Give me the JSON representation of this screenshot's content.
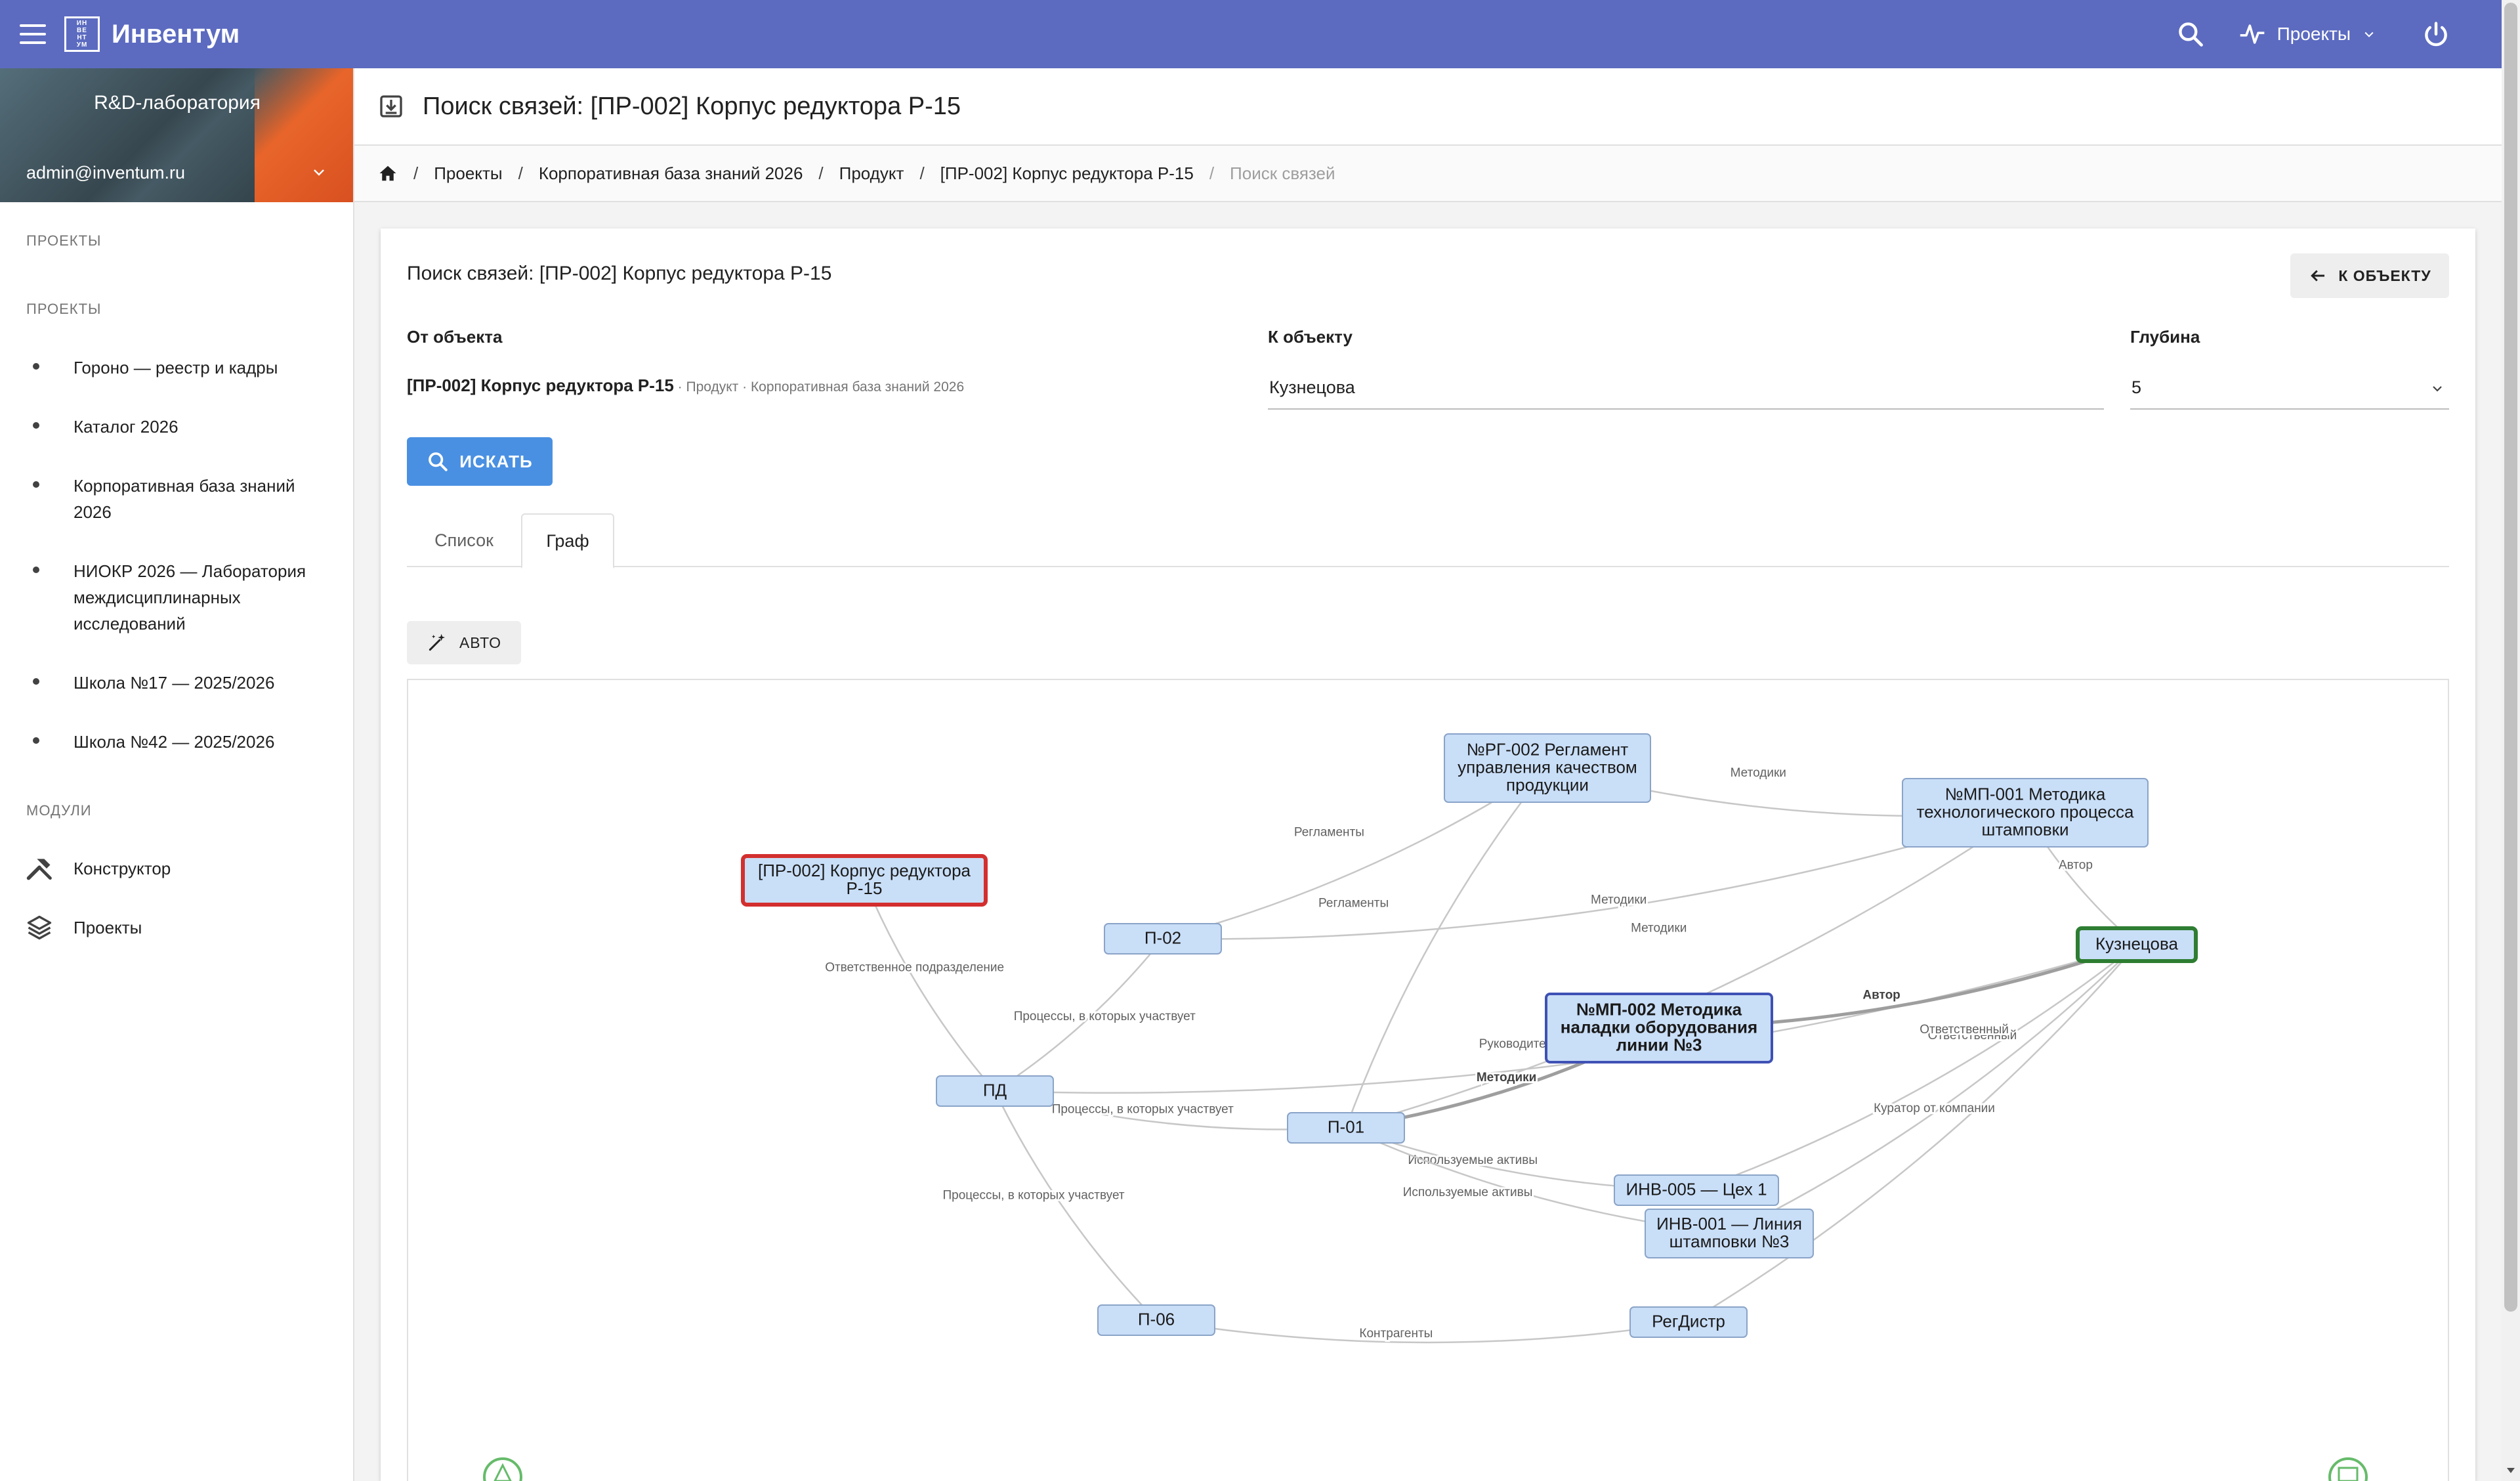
{
  "app": {
    "title": "Инвентум",
    "logo_text": "ИНВЕНТУМ"
  },
  "topbar": {
    "projects_label": "Проекты"
  },
  "sidebar": {
    "org": "R&D-лаборатория",
    "user": "admin@inventum.ru",
    "section_projects_1": "ПРОЕКТЫ",
    "section_projects_2": "ПРОЕКТЫ",
    "projects": [
      "Гороно — реестр и кадры",
      "Каталог 2026",
      "Корпоративная база знаний 2026",
      "НИОКР 2026 — Лаборатория междисциплинарных исследований",
      "Школа №17 — 2025/2026",
      "Школа №42 — 2025/2026"
    ],
    "section_modules": "МОДУЛИ",
    "modules": [
      "Конструктор",
      "Проекты"
    ]
  },
  "page": {
    "title": "Поиск связей: [ПР-002] Корпус редуктора Р-15",
    "breadcrumb": [
      "Проекты",
      "Корпоративная база знаний 2026",
      "Продукт",
      "[ПР-002] Корпус редуктора Р-15"
    ],
    "breadcrumb_current": "Поиск связей"
  },
  "card": {
    "title": "Поиск связей: [ПР-002] Корпус редуктора Р-15",
    "back_label": "К ОБЪЕКТУ",
    "from_label": "От объекта",
    "from_value": "[ПР-002] Корпус редуктора Р-15",
    "from_meta": " · Продукт · Корпоративная база знаний 2026",
    "to_label": "К объекту",
    "to_value": "Кузнецова",
    "depth_label": "Глубина",
    "depth_value": "5",
    "search_label": "ИСКАТЬ",
    "tabs": [
      "Список",
      "Граф"
    ],
    "auto_label": "АВТО"
  },
  "graph": {
    "nodes": [
      {
        "id": "start",
        "lines": [
          "[ПР-002] Корпус редуктора",
          "Р-15"
        ],
        "style": "start"
      },
      {
        "id": "rg002",
        "lines": [
          "№РГ-002 Регламент",
          "управления качеством",
          "продукции"
        ],
        "style": "normal"
      },
      {
        "id": "mp001",
        "lines": [
          "№МП-001 Методика",
          "технологического процесса",
          "штамповки"
        ],
        "style": "normal"
      },
      {
        "id": "kuz",
        "lines": [
          "Кузнецова"
        ],
        "style": "end"
      },
      {
        "id": "p02",
        "lines": [
          "П-02"
        ],
        "style": "normal"
      },
      {
        "id": "pd",
        "lines": [
          "ПД"
        ],
        "style": "normal"
      },
      {
        "id": "mp002",
        "lines": [
          "№МП-002 Методика",
          "наладки оборудования",
          "линии №3"
        ],
        "style": "focus"
      },
      {
        "id": "p01",
        "lines": [
          "П-01"
        ],
        "style": "normal"
      },
      {
        "id": "inv005",
        "lines": [
          "ИНВ-005 — Цех 1"
        ],
        "style": "normal"
      },
      {
        "id": "inv001",
        "lines": [
          "ИНВ-001 — Линия",
          "штамповки №3"
        ],
        "style": "normal"
      },
      {
        "id": "p06",
        "lines": [
          "П-06"
        ],
        "style": "normal"
      },
      {
        "id": "regd",
        "lines": [
          "РегДистр"
        ],
        "style": "normal"
      }
    ],
    "edges": [
      {
        "from": "start",
        "to": "pd",
        "label": "Ответственное подразделение"
      },
      {
        "from": "pd",
        "to": "p02",
        "label": "Процессы, в которых участвует"
      },
      {
        "from": "pd",
        "to": "p01",
        "label": "Процессы, в которых участвует"
      },
      {
        "from": "pd",
        "to": "p06",
        "label": "Процессы, в которых участвует"
      },
      {
        "from": "pd",
        "to": "kuz",
        "label": "Руководитель"
      },
      {
        "from": "p02",
        "to": "rg002",
        "label": "Регламенты"
      },
      {
        "from": "p02",
        "to": "mp001",
        "label": "Методики"
      },
      {
        "from": "rg002",
        "to": "mp001",
        "label": "Методики"
      },
      {
        "from": "rg002",
        "to": "p01",
        "label": "Регламенты"
      },
      {
        "from": "p01",
        "to": "mp001",
        "label": "Методики"
      },
      {
        "from": "p01",
        "to": "mp002",
        "label": "Методики"
      },
      {
        "from": "p01",
        "to": "inv005",
        "label": "Используемые активы"
      },
      {
        "from": "p01",
        "to": "inv001",
        "label": "Используемые активы"
      },
      {
        "from": "mp001",
        "to": "kuz",
        "label": "Автор"
      },
      {
        "from": "mp002",
        "to": "kuz",
        "label": "Автор"
      },
      {
        "from": "inv005",
        "to": "kuz",
        "label": "Ответственный"
      },
      {
        "from": "inv001",
        "to": "kuz",
        "label": "Ответственный"
      },
      {
        "from": "regd",
        "to": "kuz",
        "label": "Куратор от компании"
      },
      {
        "from": "p06",
        "to": "regd",
        "label": "Контрагенты"
      }
    ]
  },
  "colors": {
    "topbar": "#5c6bc0",
    "primary_button": "#4a90e2",
    "node_fill": "#c9def7",
    "start_border": "#d32f2f",
    "end_border": "#2e7d32",
    "focus_border": "#3f51b5"
  }
}
